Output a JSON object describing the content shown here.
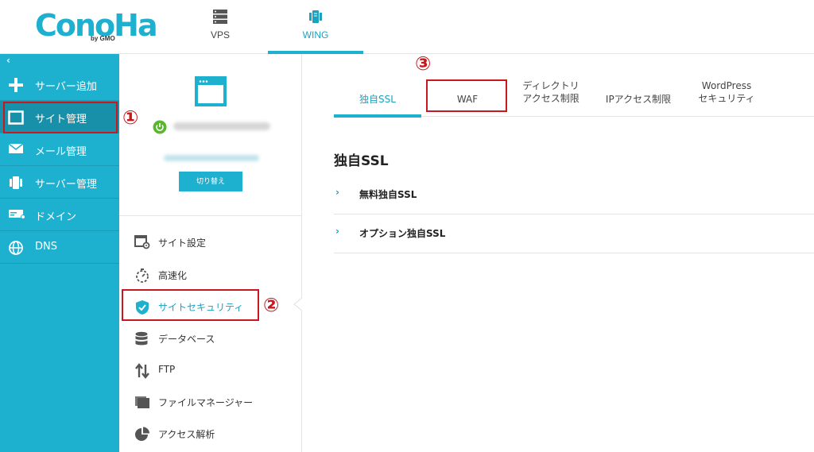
{
  "header": {
    "logo_text": "ConoHa",
    "logo_sub": "by GMO",
    "nav": [
      {
        "label": "VPS",
        "icon": "server-icon"
      },
      {
        "label": "WING",
        "icon": "wing-server-icon"
      }
    ]
  },
  "sidebar": {
    "collapse_glyph": "‹",
    "items": [
      {
        "label": "サーバー追加",
        "icon": "plus-icon"
      },
      {
        "label": "サイト管理",
        "icon": "window-icon"
      },
      {
        "label": "メール管理",
        "icon": "mail-icon"
      },
      {
        "label": "サーバー管理",
        "icon": "server-manage-icon"
      },
      {
        "label": "ドメイン",
        "icon": "domain-icon"
      },
      {
        "label": "DNS",
        "icon": "globe-icon"
      }
    ]
  },
  "site_card": {
    "switch_label": "切り替え"
  },
  "site_menu": [
    {
      "label": "サイト設定",
      "icon": "site-settings-icon"
    },
    {
      "label": "高速化",
      "icon": "stopwatch-icon"
    },
    {
      "label": "サイトセキュリティ",
      "icon": "shield-icon"
    },
    {
      "label": "データベース",
      "icon": "database-icon"
    },
    {
      "label": "FTP",
      "icon": "transfer-arrows-icon"
    },
    {
      "label": "ファイルマネージャー",
      "icon": "folder-icon"
    },
    {
      "label": "アクセス解析",
      "icon": "pie-chart-icon"
    }
  ],
  "tabs": [
    {
      "label": "独自SSL"
    },
    {
      "label": "WAF"
    },
    {
      "label": "ディレクトリ",
      "label2": "アクセス制限"
    },
    {
      "label": "IPアクセス制限"
    },
    {
      "label": "WordPress",
      "label2": "セキュリティ"
    }
  ],
  "content": {
    "title": "独自SSL",
    "rows": [
      {
        "chevron": "›",
        "label": "無料独自SSL"
      },
      {
        "chevron": "›",
        "label": "オプション独自SSL"
      }
    ]
  },
  "annotations": {
    "step1": "①",
    "step2": "②",
    "step3": "③",
    "color": "#c8171e"
  },
  "colors": {
    "brand": "#1eb0cf",
    "sidebar_active": "#1890a9",
    "power_green": "#5cb531"
  }
}
